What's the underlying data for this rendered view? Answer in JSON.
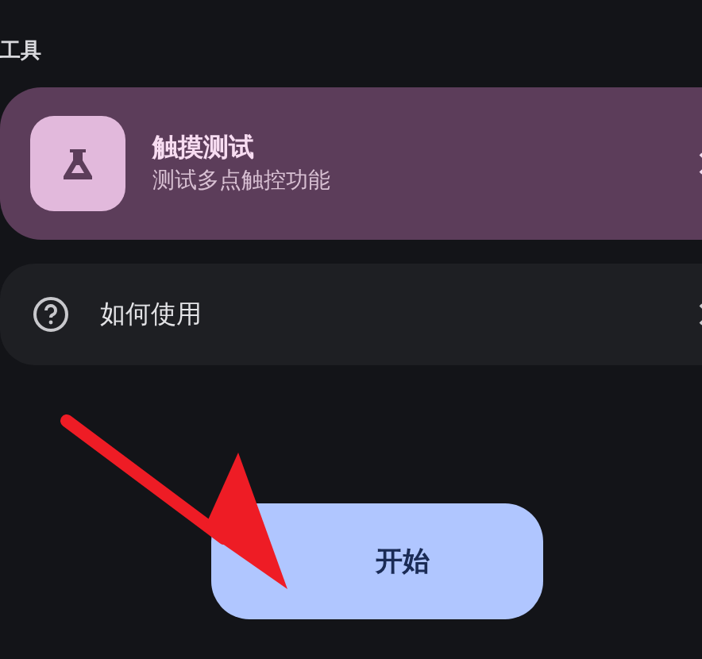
{
  "section_title": "工具",
  "tool_card": {
    "title": "触摸测试",
    "subtitle": "测试多点触控功能"
  },
  "help_row": {
    "label": "如何使用"
  },
  "start_button": {
    "label": "开始"
  }
}
